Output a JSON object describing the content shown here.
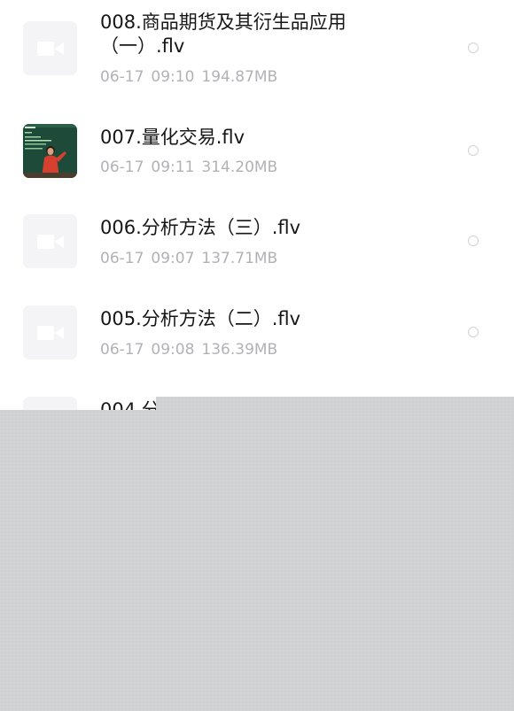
{
  "files": [
    {
      "name": "008.商品期货及其衍生品应用（一）.flv",
      "date": "06-17",
      "time": "09:10",
      "size": "194.87MB",
      "thumbnail": "video-placeholder-icon"
    },
    {
      "name": "007.量化交易.flv",
      "date": "06-17",
      "time": "09:11",
      "size": "314.20MB",
      "thumbnail": "video-frame"
    },
    {
      "name": "006.分析方法（三）.flv",
      "date": "06-17",
      "time": "09:07",
      "size": "137.71MB",
      "thumbnail": "video-placeholder-icon"
    },
    {
      "name": "005.分析方法（二）.flv",
      "date": "06-17",
      "time": "09:08",
      "size": "136.39MB",
      "thumbnail": "video-placeholder-icon"
    },
    {
      "name": "004.分",
      "thumbnail": "video-placeholder-icon"
    }
  ],
  "colors": {
    "title": "#161616",
    "meta": "#b2b2b6",
    "thumb_bg": "#f4f3f5",
    "overlay": "#d2d3d5"
  }
}
